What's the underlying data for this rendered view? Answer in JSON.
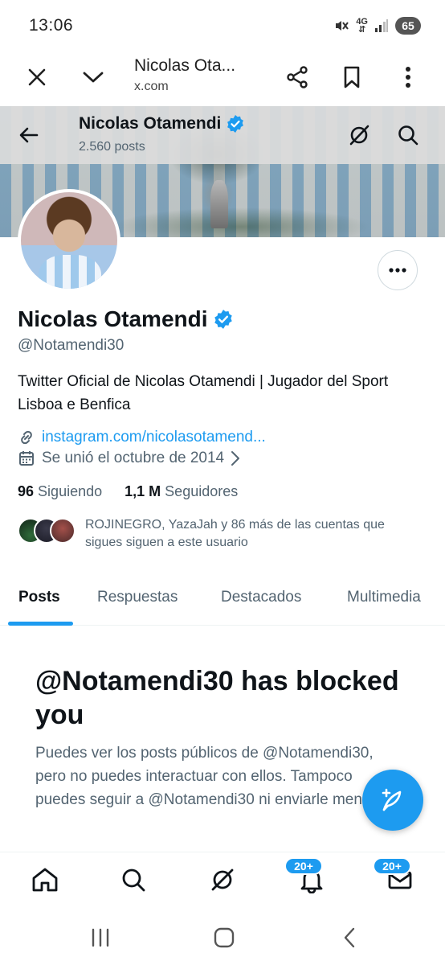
{
  "status_bar": {
    "time": "13:06",
    "network": "4G",
    "battery": "65",
    "icons": [
      "mute-icon",
      "network-4g-icon",
      "signal-icon",
      "battery-icon"
    ]
  },
  "browser_bar": {
    "title": "Nicolas Ota...",
    "url": "x.com",
    "icons": [
      "close-icon",
      "chevron-down-icon",
      "share-icon",
      "bookmark-icon",
      "more-vertical-icon"
    ]
  },
  "header": {
    "name": "Nicolas Otamendi",
    "posts": "2.560 posts",
    "icons": [
      "back-arrow-icon",
      "verified-icon",
      "grok-icon",
      "search-icon"
    ]
  },
  "profile": {
    "name": "Nicolas Otamendi",
    "handle": "@Notamendi30",
    "bio": "Twitter Oficial de Nicolas Otamendi | Jugador del Sport Lisboa e Benfica",
    "link": "instagram.com/nicolasotamend...",
    "joined": "Se unió el octubre de 2014",
    "following_count": "96",
    "following_label": "Siguiendo",
    "followers_count": "1,1 M",
    "followers_label": "Seguidores",
    "followers_you_know": "ROJINEGRO, YazaJah y 86 más de las cuentas que sigues siguen a este usuario"
  },
  "tabs": [
    {
      "label": "Posts",
      "active": true
    },
    {
      "label": "Respuestas",
      "active": false
    },
    {
      "label": "Destacados",
      "active": false
    },
    {
      "label": "Multimedia",
      "active": false
    }
  ],
  "blocked": {
    "title": "@Notamendi30 has blocked you",
    "text": "Puedes ver los posts públicos de @Notamendi30, pero no puedes interactuar con ellos. Tampoco puedes seguir a @Notamendi30 ni enviarle mensajes."
  },
  "bottom_nav": {
    "items": [
      "home-icon",
      "search-icon",
      "grok-icon",
      "notifications-icon",
      "messages-icon"
    ],
    "notifications_badge": "20+",
    "messages_badge": "20+"
  },
  "colors": {
    "accent": "#1d9bf0",
    "text_primary": "#0f1419",
    "text_secondary": "#536471"
  }
}
